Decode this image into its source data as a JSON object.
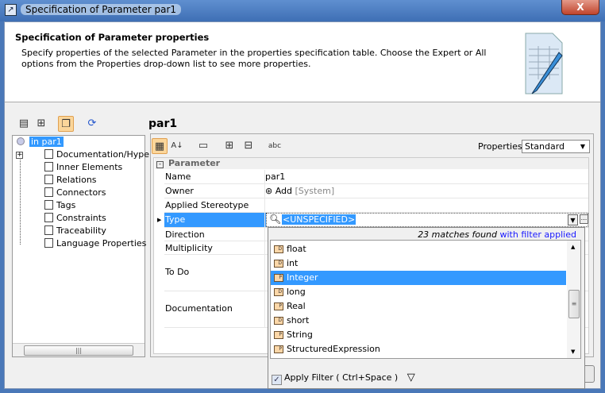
{
  "window": {
    "title": "Specification of Parameter par1",
    "close_label": "X"
  },
  "header": {
    "title": "Specification of Parameter properties",
    "description": "Specify properties of the selected Parameter in the properties specification table. Choose the Expert or All options from the Properties drop-down list to see more properties."
  },
  "element_name": "par1",
  "tree": {
    "root": "in par1",
    "items": [
      "Documentation/Hyperlinks",
      "Inner Elements",
      "Relations",
      "Connectors",
      "Tags",
      "Constraints",
      "Traceability",
      "Language Properties"
    ]
  },
  "properties": {
    "label": "Properties:",
    "selected": "Standard"
  },
  "table": {
    "group": "Parameter",
    "rows": [
      {
        "label": "Name",
        "value": "par1"
      },
      {
        "label": "Owner",
        "value": "Add",
        "extra": "[System]"
      },
      {
        "label": "Applied Stereotype",
        "value": ""
      },
      {
        "label": "Type",
        "value": "<UNSPECIFIED>"
      },
      {
        "label": "Direction",
        "value": ""
      },
      {
        "label": "Multiplicity",
        "value": ""
      },
      {
        "label": "To Do",
        "value": ""
      },
      {
        "label": "Documentation",
        "value": ""
      }
    ]
  },
  "popup": {
    "matches": "23 matches found",
    "filter_note": "with filter applied",
    "items": [
      {
        "name": "float",
        "kind": "D"
      },
      {
        "name": "int",
        "kind": "D"
      },
      {
        "name": "Integer",
        "kind": "P"
      },
      {
        "name": "long",
        "kind": "D"
      },
      {
        "name": "Real",
        "kind": "P"
      },
      {
        "name": "short",
        "kind": "D"
      },
      {
        "name": "String",
        "kind": "P"
      },
      {
        "name": "StructuredExpression",
        "kind": "P"
      }
    ],
    "selected": "Integer",
    "apply_filter": "Apply Filter ( Ctrl+Space )",
    "apply_filter_checked": true
  },
  "colors": {
    "selection": "#3399ff",
    "titlebar": "#3e6fb5"
  }
}
